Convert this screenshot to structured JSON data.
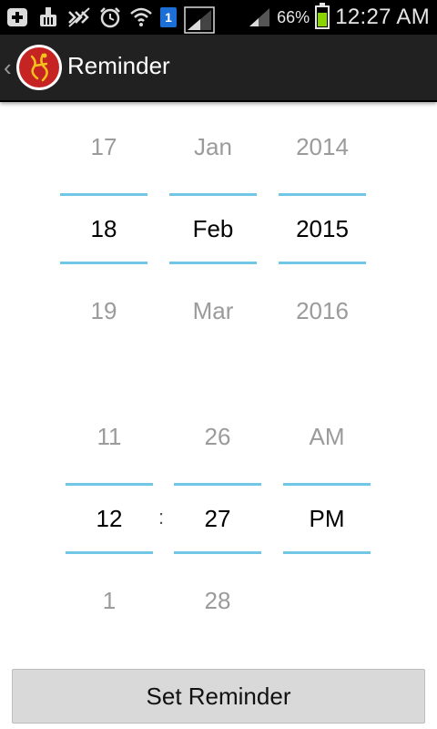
{
  "status_bar": {
    "icons": [
      "add-icon",
      "cleaner-icon",
      "no-signal-icon",
      "alarm-icon",
      "wifi-icon",
      "sim-icon",
      "signal-icon",
      "signal-weak-icon",
      "battery-icon"
    ],
    "sim_number": "1",
    "battery_percent": "66%",
    "time": "12:27 AM",
    "battery_fill": 0.66,
    "battery_color": "#8ad400"
  },
  "action_bar": {
    "title": "Reminder",
    "background": "#212121"
  },
  "date_picker": {
    "day": {
      "prev": "17",
      "current": "18",
      "next": "19"
    },
    "month": {
      "prev": "Jan",
      "current": "Feb",
      "next": "Mar"
    },
    "year": {
      "prev": "2014",
      "current": "2015",
      "next": "2016"
    }
  },
  "time_picker": {
    "hour": {
      "prev": "11",
      "current": "12",
      "next": "1"
    },
    "separator": ":",
    "minute": {
      "prev": "26",
      "current": "27",
      "next": "28"
    },
    "ampm": {
      "prev": "AM",
      "current": "PM",
      "next": ""
    }
  },
  "set_button": {
    "label": "Set Reminder"
  },
  "accent_color": "#73c7e6"
}
